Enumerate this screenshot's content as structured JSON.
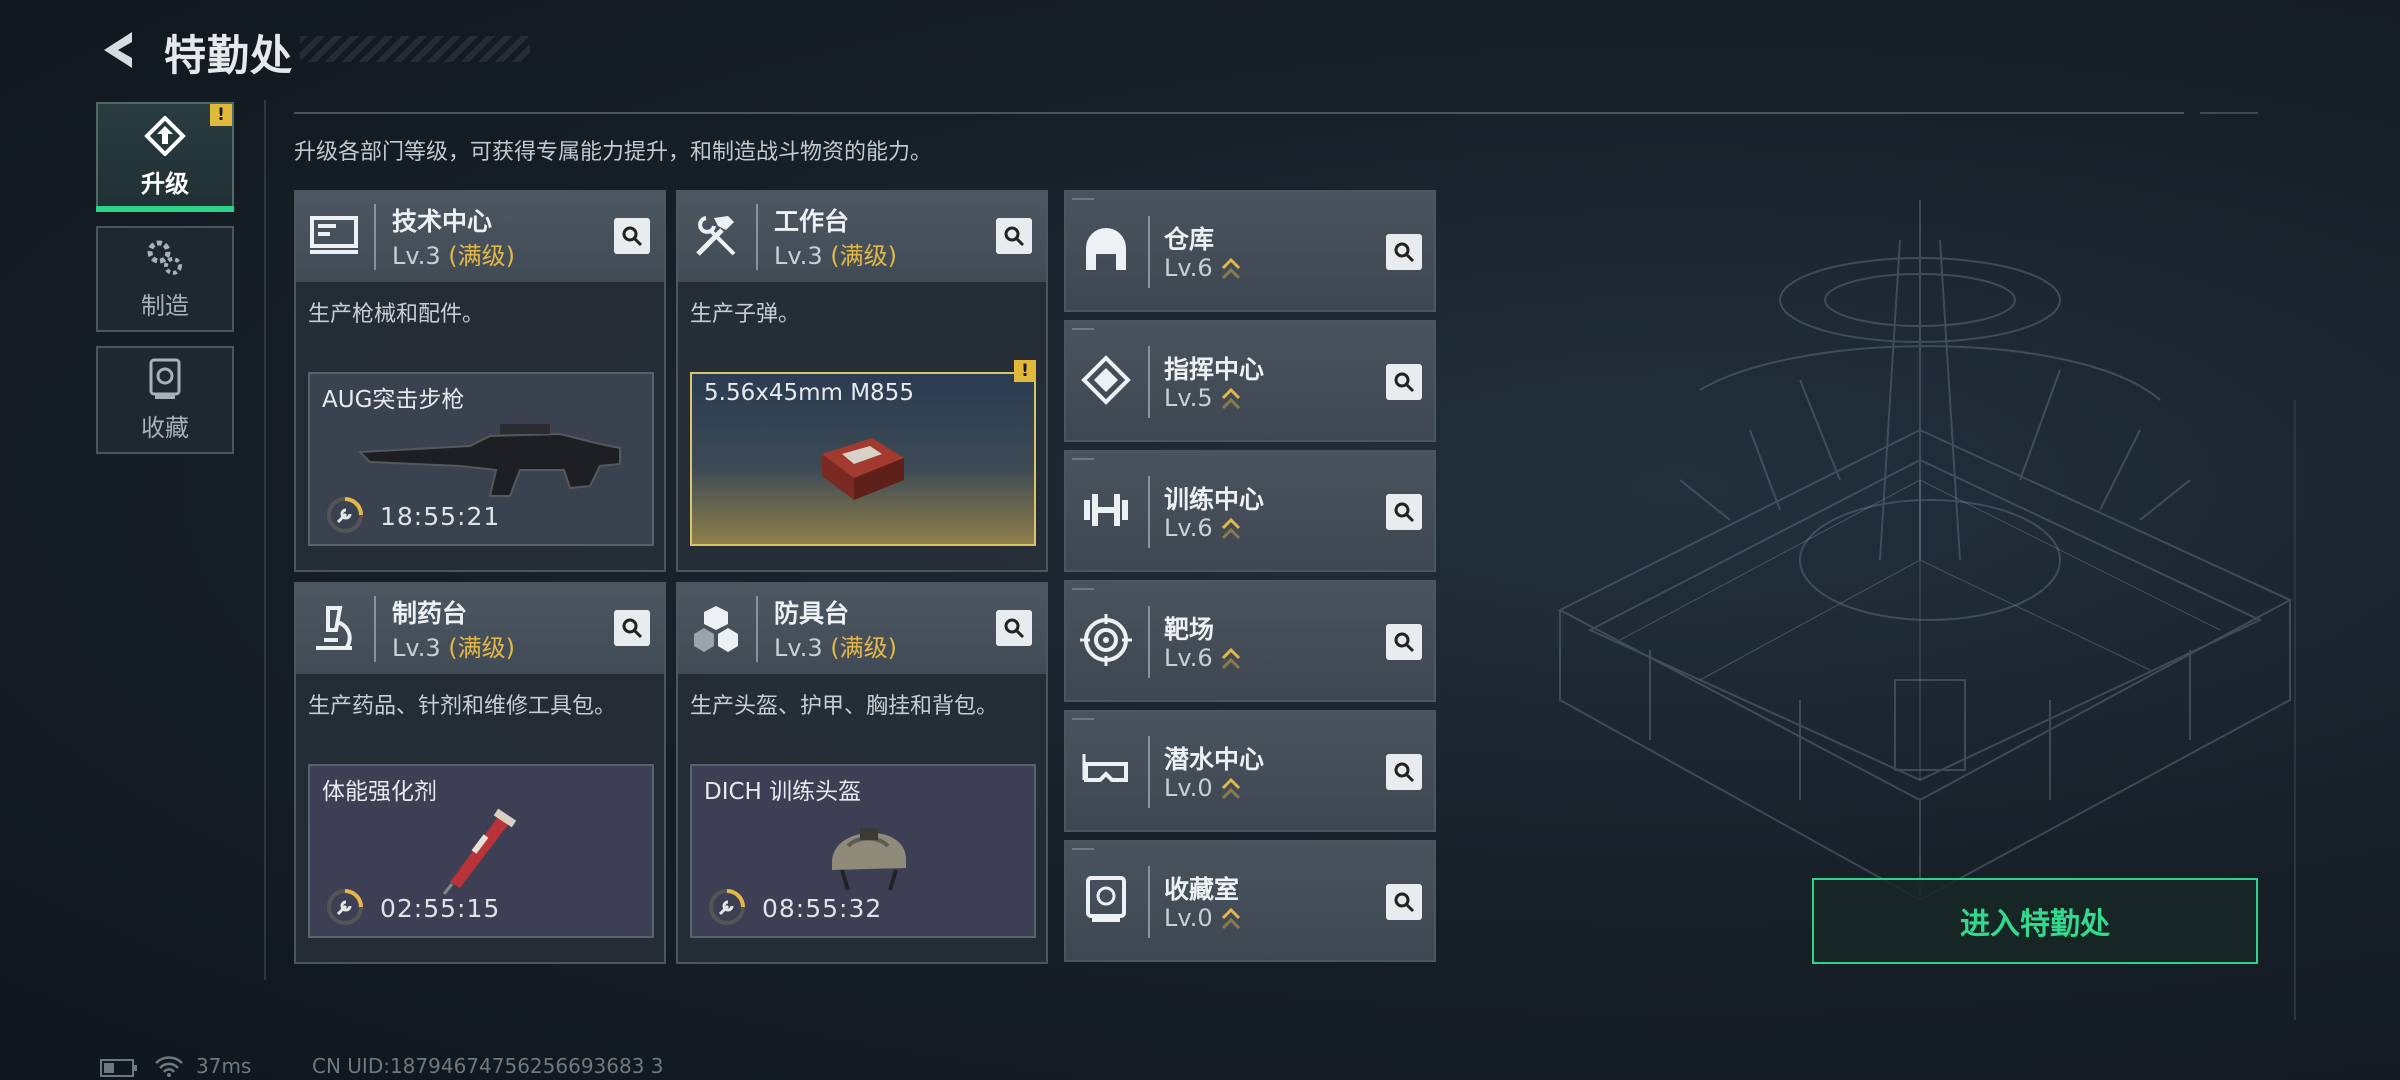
{
  "header": {
    "title": "特勤处"
  },
  "sidebar": {
    "tabs": [
      {
        "label": "升级",
        "active": true,
        "alert": "!"
      },
      {
        "label": "制造",
        "active": false
      },
      {
        "label": "收藏",
        "active": false
      }
    ]
  },
  "subtitle": "升级各部门等级，可获得专属能力提升，和制造战斗物资的能力。",
  "stations": [
    {
      "name": "技术中心",
      "level": "Lv.3",
      "level_note": "(满级)",
      "desc": "生产枪械和配件。",
      "craft": {
        "item": "AUG突击步枪",
        "timer": "18:55:21"
      }
    },
    {
      "name": "工作台",
      "level": "Lv.3",
      "level_note": "(满级)",
      "desc": "生产子弹。",
      "craft": {
        "item": "5.56x45mm M855",
        "timer": "",
        "alert": "!"
      }
    },
    {
      "name": "制药台",
      "level": "Lv.3",
      "level_note": "(满级)",
      "desc": "生产药品、针剂和维修工具包。",
      "craft": {
        "item": "体能强化剂",
        "timer": "02:55:15"
      }
    },
    {
      "name": "防具台",
      "level": "Lv.3",
      "level_note": "(满级)",
      "desc": "生产头盔、护甲、胸挂和背包。",
      "craft": {
        "item": "DICH 训练头盔",
        "timer": "08:55:32"
      }
    }
  ],
  "facilities": [
    {
      "name": "仓库",
      "level": "Lv.6"
    },
    {
      "name": "指挥中心",
      "level": "Lv.5"
    },
    {
      "name": "训练中心",
      "level": "Lv.6"
    },
    {
      "name": "靶场",
      "level": "Lv.6"
    },
    {
      "name": "潜水中心",
      "level": "Lv.0"
    },
    {
      "name": "收藏室",
      "level": "Lv.0"
    }
  ],
  "enter_button": "进入特勤处",
  "footer": {
    "ping": "37ms",
    "uid": "CN UID:18794674756256693683 3"
  },
  "colors": {
    "accent": "#2ed38a",
    "max_level": "#e3b84a",
    "alert": "#e0b83a"
  }
}
